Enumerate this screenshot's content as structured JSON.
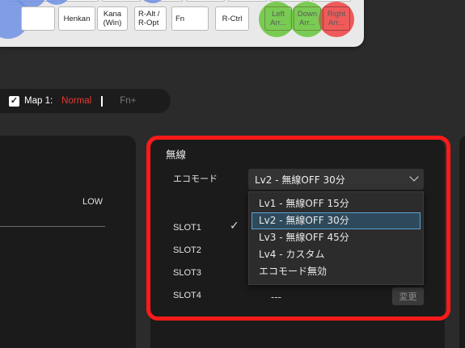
{
  "keyboard": {
    "keys": {
      "henkan": "Henkan",
      "kana": "Kana\n(Win)",
      "ralt": "R-Alt /\nR-Opt",
      "fn": "Fn",
      "rctrl": "R-Ctrl",
      "left": "Left\nArr...",
      "down": "Down\nArr...",
      "right": "Right\nArr..."
    },
    "colors": {
      "blue_blob": "#6f8fe3",
      "green_blob": "#6dc842",
      "red_blob": "#f04a4a"
    }
  },
  "map_bar": {
    "checked": true,
    "label": "Map 1:",
    "normal": "Normal",
    "fn": "Fn+"
  },
  "left_panel": {
    "low_label": "LOW"
  },
  "wireless": {
    "title": "無線",
    "eco_mode_label": "エコモード",
    "selected_value": "Lv2 - 無線OFF 30分",
    "options": [
      "Lv1 - 無線OFF 15分",
      "Lv2 - 無線OFF 30分",
      "Lv3 - 無線OFF 45分",
      "Lv4 - カスタム",
      "エコモード無効"
    ],
    "selected_index": 1,
    "slots": [
      "SLOT1",
      "SLOT2",
      "SLOT3",
      "SLOT4"
    ],
    "active_slot_index": 0,
    "slot4_value": "---",
    "change_button": "変更"
  },
  "colors": {
    "highlight": "#ff1a1a",
    "normal_text": "#e53935",
    "panel_bg": "#1b1b1b",
    "page_bg": "#2b2b2b"
  }
}
